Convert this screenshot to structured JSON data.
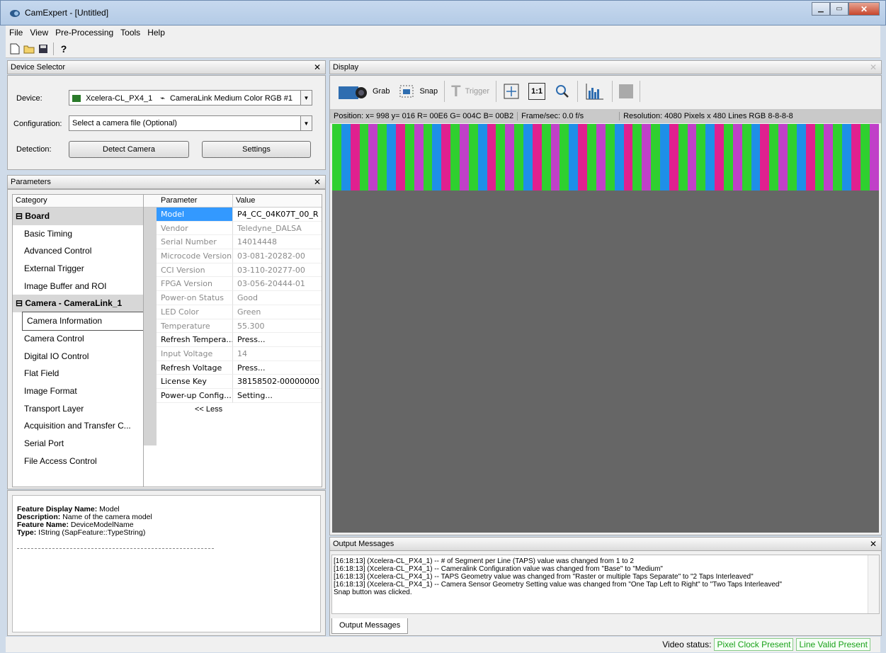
{
  "window": {
    "title": "CamExpert - [Untitled]"
  },
  "menu": [
    "File",
    "View",
    "Pre-Processing",
    "Tools",
    "Help"
  ],
  "device_selector": {
    "title": "Device Selector",
    "device_label": "Device:",
    "device_value": "Xcelera-CL_PX4_1",
    "device_config": "CameraLink Medium Color RGB #1",
    "configuration_label": "Configuration:",
    "configuration_value": "Select a camera file (Optional)",
    "detection_label": "Detection:",
    "detect_button": "Detect Camera",
    "settings_button": "Settings"
  },
  "parameters": {
    "title": "Parameters",
    "category_header": "Category",
    "parameter_header": "Parameter",
    "value_header": "Value",
    "categories": [
      {
        "label": "Board",
        "group": true
      },
      {
        "label": "Basic Timing"
      },
      {
        "label": "Advanced Control"
      },
      {
        "label": "External Trigger"
      },
      {
        "label": "Image Buffer and ROI"
      },
      {
        "label": "Camera - CameraLink_1",
        "group": true
      },
      {
        "label": "Camera Information",
        "selected": true
      },
      {
        "label": "Camera Control"
      },
      {
        "label": "Digital IO Control"
      },
      {
        "label": "Flat Field"
      },
      {
        "label": "Image Format"
      },
      {
        "label": "Transport Layer"
      },
      {
        "label": "Acquisition and Transfer C..."
      },
      {
        "label": "Serial Port"
      },
      {
        "label": "File Access Control"
      }
    ],
    "rows": [
      {
        "name": "Model",
        "value": "P4_CC_04K07T_00_R",
        "state": "selected"
      },
      {
        "name": "Vendor",
        "value": "Teledyne_DALSA",
        "state": "ro"
      },
      {
        "name": "Serial Number",
        "value": "14014448",
        "state": "ro"
      },
      {
        "name": "Microcode Version",
        "value": "03-081-20282-00",
        "state": "ro"
      },
      {
        "name": "CCI Version",
        "value": "03-110-20277-00",
        "state": "ro"
      },
      {
        "name": "FPGA Version",
        "value": "03-056-20444-01",
        "state": "ro"
      },
      {
        "name": "Power-on Status",
        "value": "Good",
        "state": "ro"
      },
      {
        "name": "LED Color",
        "value": "Green",
        "state": "ro"
      },
      {
        "name": "Temperature",
        "value": "55.300",
        "state": "ro"
      },
      {
        "name": "Refresh Tempera...",
        "value": "Press...",
        "state": "rw"
      },
      {
        "name": "Input Voltage",
        "value": "14",
        "state": "ro"
      },
      {
        "name": "Refresh Voltage",
        "value": "Press...",
        "state": "rw"
      },
      {
        "name": "License Key",
        "value": "38158502-00000000",
        "state": "rw"
      },
      {
        "name": "Power-up Config...",
        "value": "Setting...",
        "state": "rw"
      }
    ],
    "less_label": "<< Less"
  },
  "description": {
    "feature_display_name_label": "Feature Display Name:",
    "feature_display_name": "Model",
    "description_label": "Description:",
    "description": "Name of the camera model",
    "feature_name_label": "Feature Name:",
    "feature_name": "DeviceModelName",
    "type_label": "Type:",
    "type": "IString (SapFeature::TypeString)"
  },
  "display": {
    "title": "Display",
    "grab": "Grab",
    "snap": "Snap",
    "trigger": "Trigger",
    "one_to_one": "1:1",
    "position": "Position: x= 998 y= 016 R= 00E6 G= 004C B= 00B2",
    "framerate": "Frame/sec: 0.0 f/s",
    "resolution": "Resolution: 4080 Pixels x 480 Lines  RGB 8-8-8-8",
    "stripe_colors": [
      "#2fd02f",
      "#1e8fe8",
      "#e0208f",
      "#c040c8"
    ]
  },
  "output": {
    "title": "Output Messages",
    "lines": [
      "[16:18:13] (Xcelera-CL_PX4_1)  -- # of Segment per Line (TAPS) value was changed from 1 to 2",
      "[16:18:13] (Xcelera-CL_PX4_1)  -- Cameralink Configuration value was changed from \"Base\" to \"Medium\"",
      "[16:18:13] (Xcelera-CL_PX4_1)  -- TAPS Geometry value was changed from \"Raster or multiple Taps Separate\" to \"2 Taps Interleaved\"",
      "[16:18:13] (Xcelera-CL_PX4_1)  -- Camera Sensor Geometry Setting value was changed from \"One Tap Left to Right\" to \"Two Taps Interleaved\"",
      "Snap button was clicked."
    ],
    "tab": "Output Messages"
  },
  "statusbar": {
    "label": "Video status:",
    "pixel_clock": "Pixel Clock Present",
    "line_valid": "Line Valid Present"
  }
}
